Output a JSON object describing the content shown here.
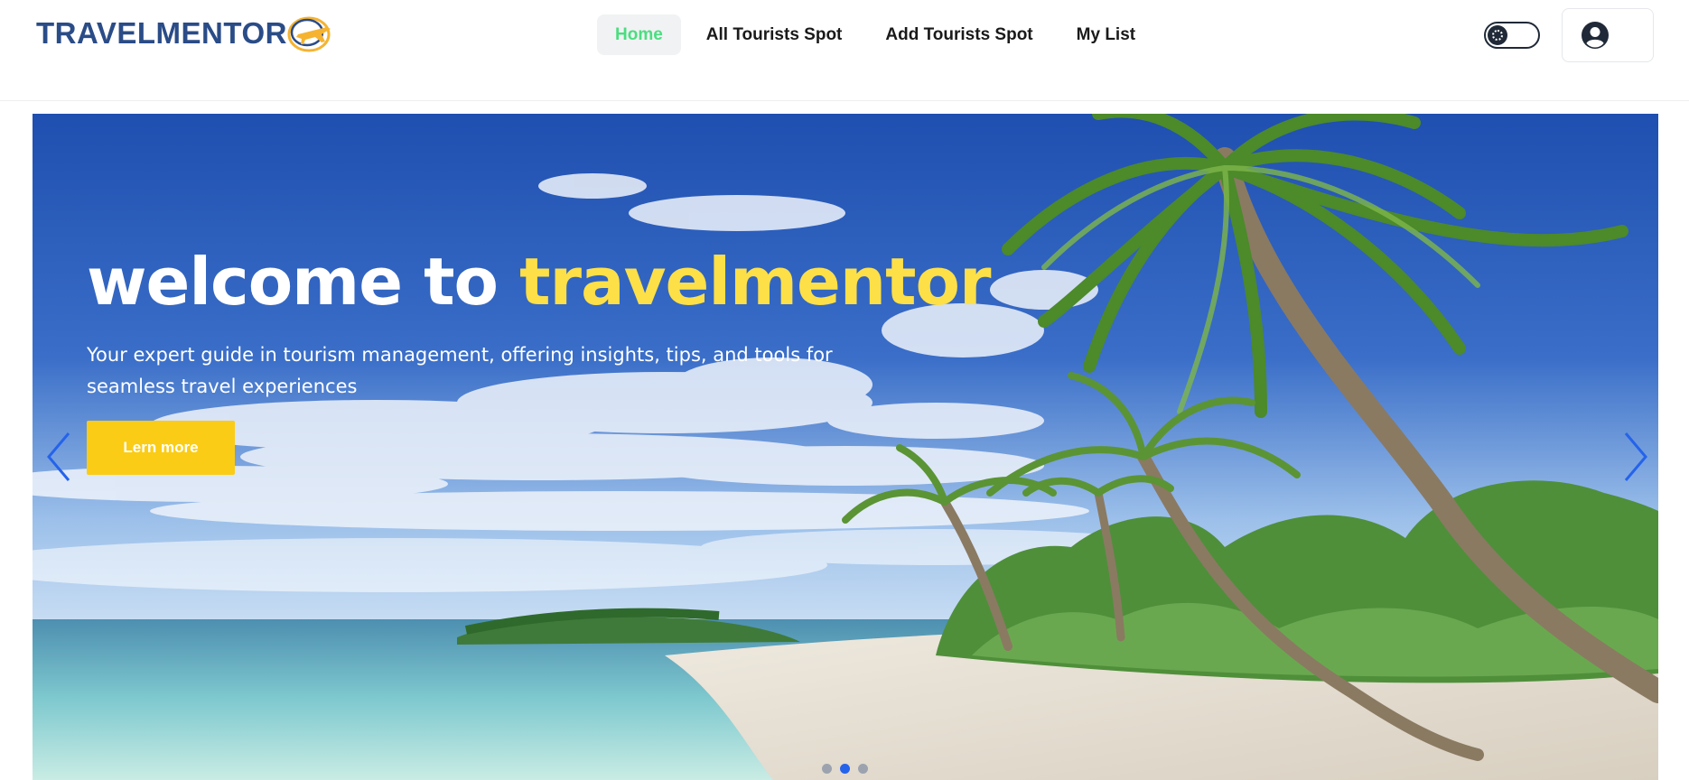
{
  "brand": {
    "name": "TRAVELMENTOR",
    "logo_icon": "plane-orbit-icon",
    "color": "#2a4c87",
    "accent_color": "#f5b331"
  },
  "nav": {
    "items": [
      {
        "label": "Home",
        "active": true
      },
      {
        "label": "All Tourists Spot",
        "active": false
      },
      {
        "label": "Add Tourists Spot",
        "active": false
      },
      {
        "label": "My List",
        "active": false
      }
    ],
    "active_color": "#4ade80"
  },
  "theme_toggle": {
    "icon": "sun-icon",
    "state": "light"
  },
  "user_menu": {
    "icon": "user-circle-icon"
  },
  "hero": {
    "title_prefix": "welcome to",
    "title_highlight": "travelmentor",
    "highlight_color": "#fde047",
    "subtitle": "Your expert guide in tourism management, offering insights, tips, and tools for seamless travel experiences",
    "cta_label": "Lern more",
    "cta_color": "#facc15",
    "prev_icon": "chevron-left-icon",
    "next_icon": "chevron-right-icon",
    "arrow_color": "#2563eb",
    "slides": 3,
    "active_slide": 2
  }
}
